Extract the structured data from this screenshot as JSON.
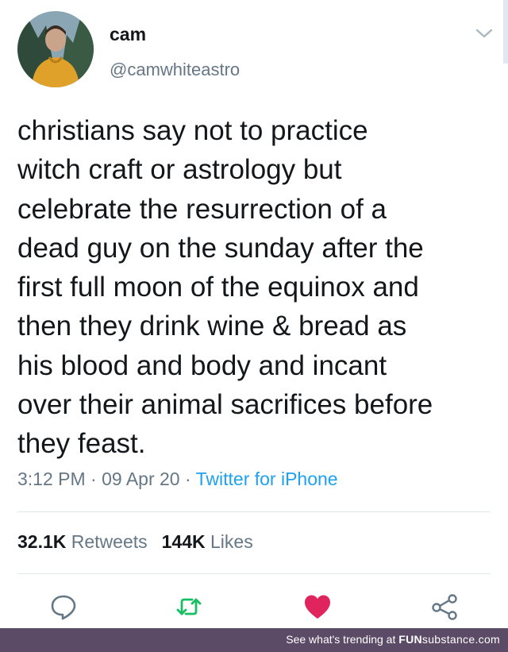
{
  "tweet": {
    "display_name": "cam",
    "handle": "@camwhiteastro",
    "text_lines": [
      "christians say not to practice",
      "witch craft or astrology but",
      "celebrate the resurrection of a",
      "dead guy on the sunday after the",
      "first full moon of the equinox and",
      "then they drink wine & bread as",
      "his blood and body and incant",
      "over their animal sacrifices before",
      "they feast."
    ],
    "time": "3:12 PM",
    "date": "09 Apr 20",
    "separator": "·",
    "source": "Twitter for iPhone",
    "retweets_count": "32.1K",
    "retweets_label": "Retweets",
    "likes_count": "144K",
    "likes_label": "Likes"
  },
  "icons": {
    "menu": "chevron-down-icon",
    "reply": "reply-icon",
    "retweet": "retweet-icon",
    "like": "heart-icon",
    "share": "share-icon"
  },
  "colors": {
    "text": "#14171a",
    "secondary": "#657786",
    "link": "#1da1f2",
    "retweet": "#17bf63",
    "like": "#e0245e",
    "footer": "#5b4b66"
  },
  "footer": {
    "text": "See what's trending at",
    "brand_bold": "FUN",
    "brand_light": "substance",
    "brand_suffix": ".com"
  }
}
